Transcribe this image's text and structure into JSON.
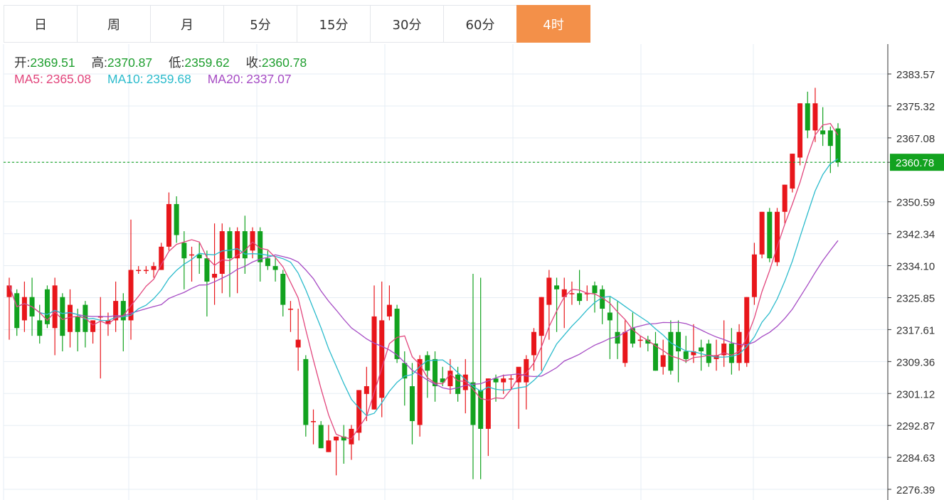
{
  "tabs": [
    {
      "label": "日",
      "active": false
    },
    {
      "label": "周",
      "active": false
    },
    {
      "label": "月",
      "active": false
    },
    {
      "label": "5分",
      "active": false
    },
    {
      "label": "15分",
      "active": false
    },
    {
      "label": "30分",
      "active": false
    },
    {
      "label": "60分",
      "active": false
    },
    {
      "label": "4时",
      "active": true
    }
  ],
  "ohlc": {
    "open_label": "开:",
    "open": "2369.51",
    "high_label": "高:",
    "high": "2370.87",
    "low_label": "低:",
    "low": "2359.62",
    "close_label": "收:",
    "close": "2360.78"
  },
  "ma": [
    {
      "label": "MA5:",
      "value": "2365.08",
      "color": "#e2457c"
    },
    {
      "label": "MA10:",
      "value": "2359.68",
      "color": "#2bbbcc"
    },
    {
      "label": "MA20:",
      "value": "2337.07",
      "color": "#a64bc4"
    }
  ],
  "colors": {
    "up": "#e8161b",
    "down": "#12a21f",
    "active_tab": "#f39049",
    "grid": "#e6edf4",
    "price_tag": "#12a21f"
  },
  "chart_data": {
    "type": "candlestick",
    "y_ticks": [
      "2383.57",
      "2375.32",
      "2367.08",
      "2360.78",
      "2350.59",
      "2342.34",
      "2334.10",
      "2325.85",
      "2317.61",
      "2309.36",
      "2301.12",
      "2292.87",
      "2284.63",
      "2276.39"
    ],
    "ylim": [
      2276.39,
      2383.57
    ],
    "current_price": "2360.78",
    "candles": [
      [
        2326,
        2331,
        2315,
        2329
      ],
      [
        2327,
        2328,
        2316,
        2318
      ],
      [
        2320,
        2330,
        2317,
        2326
      ],
      [
        2326,
        2331,
        2316,
        2321
      ],
      [
        2320,
        2324,
        2314,
        2316
      ],
      [
        2328,
        2329,
        2318,
        2319
      ],
      [
        2318,
        2331,
        2311,
        2329
      ],
      [
        2326,
        2327,
        2312,
        2316
      ],
      [
        2317,
        2328,
        2313,
        2324
      ],
      [
        2321,
        2323,
        2312,
        2317
      ],
      [
        2324,
        2325,
        2313,
        2317
      ],
      [
        2317,
        2320,
        2314,
        2320
      ],
      [
        2321,
        2326,
        2305,
        2321
      ],
      [
        2319,
        2322,
        2316,
        2320
      ],
      [
        2320,
        2330,
        2317,
        2325
      ],
      [
        2325,
        2327,
        2312,
        2320
      ],
      [
        2320,
        2346,
        2315,
        2333
      ],
      [
        2333,
        2334,
        2332,
        2333
      ],
      [
        2333,
        2334,
        2332,
        2333
      ],
      [
        2333,
        2335,
        2331,
        2334
      ],
      [
        2333,
        2340,
        2333,
        2339
      ],
      [
        2339,
        2353,
        2338,
        2350
      ],
      [
        2350,
        2352,
        2340,
        2342
      ],
      [
        2340,
        2343,
        2328,
        2336
      ],
      [
        2337,
        2339,
        2330,
        2337
      ],
      [
        2337,
        2340,
        2332,
        2336
      ],
      [
        2336,
        2338,
        2321,
        2330
      ],
      [
        2331,
        2345,
        2324,
        2332
      ],
      [
        2332,
        2345,
        2327,
        2343
      ],
      [
        2343,
        2344,
        2326,
        2336
      ],
      [
        2336,
        2344,
        2327,
        2343
      ],
      [
        2343,
        2347,
        2332,
        2336
      ],
      [
        2338,
        2344,
        2336,
        2343
      ],
      [
        2343,
        2344,
        2330,
        2335
      ],
      [
        2336,
        2338,
        2333,
        2334
      ],
      [
        2334,
        2336,
        2330,
        2333
      ],
      [
        2332,
        2333,
        2321,
        2324
      ],
      [
        2323,
        2325,
        2317,
        2323
      ],
      [
        2313,
        2323,
        2307,
        2315
      ],
      [
        2310,
        2311,
        2290,
        2293
      ],
      [
        2294,
        2297,
        2288,
        2294
      ],
      [
        2293,
        2294,
        2287,
        2287
      ],
      [
        2286,
        2293,
        2286,
        2289
      ],
      [
        2289,
        2290,
        2280,
        2290
      ],
      [
        2290,
        2293,
        2283,
        2289
      ],
      [
        2288,
        2293,
        2284,
        2292
      ],
      [
        2291,
        2302,
        2289,
        2302
      ],
      [
        2301,
        2308,
        2294,
        2303
      ],
      [
        2297,
        2329,
        2297,
        2321
      ],
      [
        2300,
        2330,
        2295,
        2320
      ],
      [
        2321,
        2329,
        2320,
        2324
      ],
      [
        2323,
        2324,
        2309,
        2310
      ],
      [
        2309,
        2312,
        2298,
        2305
      ],
      [
        2303,
        2309,
        2288,
        2294
      ],
      [
        2293,
        2311,
        2290,
        2310
      ],
      [
        2311,
        2312,
        2300,
        2307
      ],
      [
        2310,
        2312,
        2299,
        2303
      ],
      [
        2305,
        2308,
        2303,
        2304
      ],
      [
        2303,
        2310,
        2301,
        2307
      ],
      [
        2306,
        2308,
        2299,
        2301
      ],
      [
        2302,
        2310,
        2296,
        2306
      ],
      [
        2304,
        2332,
        2279,
        2293
      ],
      [
        2302,
        2331,
        2279,
        2292
      ],
      [
        2292,
        2305,
        2285,
        2305
      ],
      [
        2305,
        2306,
        2299,
        2304
      ],
      [
        2304,
        2306,
        2301,
        2305
      ],
      [
        2305,
        2306,
        2302,
        2305
      ],
      [
        2304,
        2307,
        2292,
        2308
      ],
      [
        2304,
        2311,
        2297,
        2310
      ],
      [
        2311,
        2318,
        2307,
        2317
      ],
      [
        2316,
        2326,
        2307,
        2326
      ],
      [
        2324,
        2333,
        2315,
        2331
      ],
      [
        2329,
        2331,
        2317,
        2328
      ],
      [
        2326,
        2331,
        2318,
        2328
      ],
      [
        2327,
        2330,
        2324,
        2327
      ],
      [
        2327,
        2333,
        2324,
        2325
      ],
      [
        2327,
        2329,
        2325,
        2327
      ],
      [
        2329,
        2330,
        2322,
        2327
      ],
      [
        2328,
        2329,
        2319,
        2323
      ],
      [
        2322,
        2326,
        2310,
        2320
      ],
      [
        2317,
        2325,
        2310,
        2314
      ],
      [
        2309,
        2320,
        2308,
        2317
      ],
      [
        2318,
        2322,
        2313,
        2314
      ],
      [
        2315,
        2316,
        2313,
        2315
      ],
      [
        2315,
        2316,
        2312,
        2314
      ],
      [
        2314,
        2317,
        2307,
        2307
      ],
      [
        2308,
        2315,
        2306,
        2311
      ],
      [
        2317,
        2320,
        2306,
        2307
      ],
      [
        2317,
        2320,
        2304,
        2312
      ],
      [
        2312,
        2316,
        2309,
        2310
      ],
      [
        2311,
        2319,
        2309,
        2312
      ],
      [
        2313,
        2315,
        2307,
        2312
      ],
      [
        2314,
        2315,
        2308,
        2309
      ],
      [
        2310,
        2315,
        2307,
        2311
      ],
      [
        2311,
        2320,
        2308,
        2314
      ],
      [
        2314,
        2318,
        2306,
        2309
      ],
      [
        2309,
        2319,
        2307,
        2317
      ],
      [
        2309,
        2326,
        2308,
        2326
      ],
      [
        2326,
        2340,
        2324,
        2337
      ],
      [
        2337,
        2348,
        2336,
        2348
      ],
      [
        2348,
        2349,
        2335,
        2336
      ],
      [
        2335,
        2349,
        2334,
        2348
      ],
      [
        2348,
        2355,
        2345,
        2355
      ],
      [
        2354,
        2363,
        2353,
        2363
      ],
      [
        2362,
        2376,
        2360,
        2376
      ],
      [
        2376,
        2379,
        2367,
        2369
      ],
      [
        2369,
        2380,
        2366,
        2376
      ],
      [
        2369,
        2375,
        2365,
        2368
      ],
      [
        2369,
        2370,
        2358,
        2365
      ],
      [
        2369.51,
        2370.87,
        2359.62,
        2360.78
      ]
    ],
    "ma5_visible_from": 0,
    "ma20_visible_from": 0
  }
}
